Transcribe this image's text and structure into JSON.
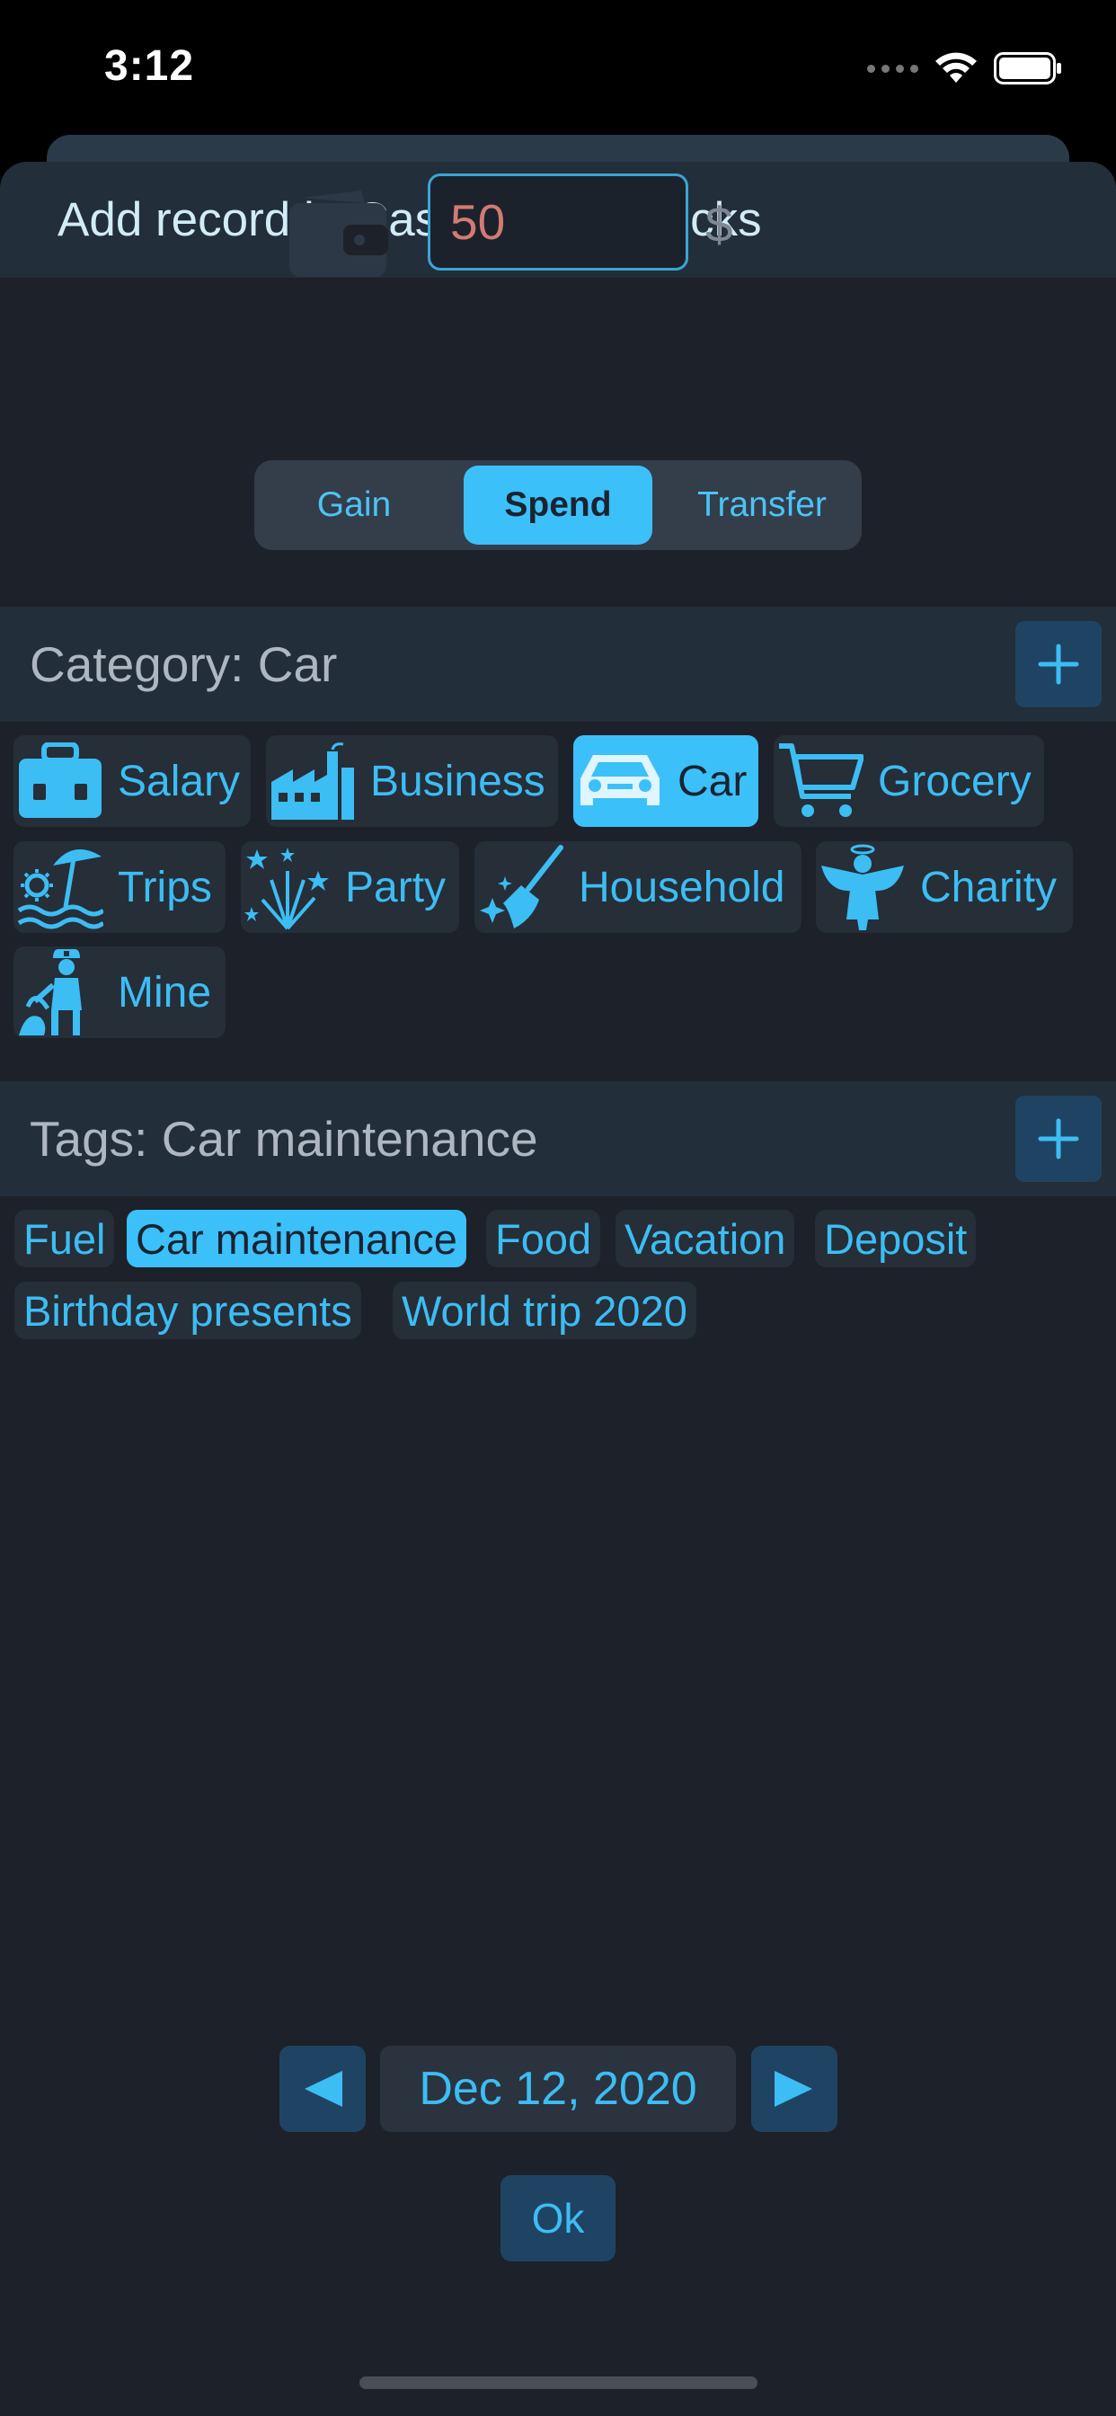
{
  "status": {
    "time": "3:12"
  },
  "sheet": {
    "title": "Add record in Cash/Pocket bucks"
  },
  "amount": {
    "value": "50",
    "currency": "$"
  },
  "type_selector": {
    "options": [
      "Gain",
      "Spend",
      "Transfer"
    ],
    "selected": "Spend"
  },
  "category": {
    "header": "Category: Car",
    "items": [
      {
        "label": "Salary",
        "icon": "briefcase-icon"
      },
      {
        "label": "Business",
        "icon": "factory-icon"
      },
      {
        "label": "Car",
        "icon": "car-icon",
        "selected": true
      },
      {
        "label": "Grocery",
        "icon": "cart-icon"
      },
      {
        "label": "Trips",
        "icon": "beach-icon"
      },
      {
        "label": "Party",
        "icon": "fireworks-icon"
      },
      {
        "label": "Household",
        "icon": "broom-icon"
      },
      {
        "label": "Charity",
        "icon": "angel-icon"
      },
      {
        "label": "Mine",
        "icon": "miner-icon"
      }
    ]
  },
  "tags": {
    "header": "Tags: Car maintenance",
    "items": [
      "Fuel",
      "Car maintenance",
      "Food",
      "Vacation",
      "Deposit",
      "Birthday presents",
      "World trip 2020"
    ],
    "selected": "Car maintenance"
  },
  "date": {
    "value": "Dec 12, 2020"
  },
  "ok_label": "Ok",
  "colors": {
    "accent": "#3bc0fa",
    "background": "#1d2129",
    "bar": "#222e3a",
    "amount_text": "#d47a72"
  }
}
